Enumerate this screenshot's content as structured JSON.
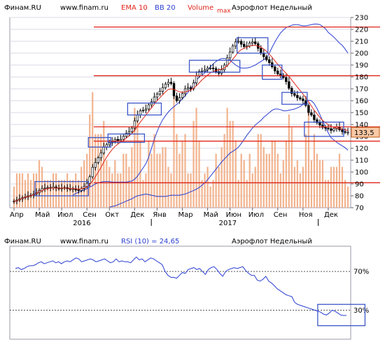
{
  "chart_data": [
    {
      "type": "candlestick",
      "header": {
        "source": "Финам.RU",
        "url": "www.finam.ru",
        "ema": "EMA 10",
        "bb": "BB 20",
        "volume": "Volume",
        "volume_scale": "max",
        "title": "Аэрофлот Недельный"
      },
      "ylim": [
        70,
        230
      ],
      "y_ticks": [
        70,
        80,
        90,
        100,
        110,
        120,
        130,
        140,
        150,
        160,
        170,
        180,
        190,
        200,
        210,
        220,
        230
      ],
      "x_month_labels": [
        "Апр",
        "Май",
        "Июл",
        "Сен",
        "Окт",
        "Дек",
        "Янв",
        "Мар",
        "Май",
        "Июн",
        "Июл",
        "Сен",
        "Ноя",
        "Дек"
      ],
      "x_month_weeks": [
        0,
        9,
        17,
        26,
        34,
        43,
        51,
        60,
        69,
        77,
        85,
        94,
        103,
        112
      ],
      "x_year_labels": [
        "2016",
        "2017"
      ],
      "x_year_weeks": [
        24,
        76
      ],
      "last_price_label": "133,5",
      "last_price": 133.5,
      "horizontal_lines": [
        222,
        181,
        138,
        126,
        91
      ],
      "highlight_boxes": [
        {
          "from_week": 8,
          "to_week": 26,
          "low": 80,
          "high": 92
        },
        {
          "from_week": 27,
          "to_week": 34,
          "low": 121,
          "high": 129
        },
        {
          "from_week": 34,
          "to_week": 46,
          "low": 125,
          "high": 132
        },
        {
          "from_week": 41,
          "to_week": 52,
          "low": 148,
          "high": 158
        },
        {
          "from_week": 63,
          "to_week": 80,
          "low": 184,
          "high": 194
        },
        {
          "from_week": 80,
          "to_week": 90,
          "low": 200,
          "high": 213
        },
        {
          "from_week": 89,
          "to_week": 95,
          "low": 178,
          "high": 190
        },
        {
          "from_week": 96,
          "to_week": 104,
          "low": 157,
          "high": 167
        },
        {
          "from_week": 104,
          "to_week": 117,
          "low": 130,
          "high": 142
        }
      ],
      "weeks": 120,
      "close": [
        75.5,
        76.5,
        77.5,
        78.5,
        79,
        80,
        80.5,
        81.5,
        82.5,
        84.5,
        86,
        86.5,
        87,
        86.5,
        87.5,
        86.5,
        86,
        86.5,
        87,
        86,
        85.5,
        86,
        85,
        84.5,
        86,
        88,
        90.5,
        96,
        104,
        108,
        112,
        116,
        121,
        123,
        124.5,
        125.5,
        127.5,
        126.5,
        127.5,
        130,
        132.5,
        134,
        137,
        143,
        148,
        151.5,
        152,
        153,
        156.5,
        159,
        163,
        165.5,
        168,
        171,
        174,
        175.5,
        174.5,
        164,
        160,
        162.5,
        166,
        170,
        171,
        170,
        175,
        181,
        184.5,
        185,
        186,
        187.5,
        187.5,
        187,
        184.5,
        183,
        186,
        190,
        196,
        201,
        206,
        209.5,
        210,
        207.5,
        205.5,
        206,
        208.5,
        209.5,
        208,
        204,
        200,
        197,
        194.5,
        192,
        188.5,
        185,
        182.5,
        181.5,
        179.5,
        176,
        170.5,
        166,
        164.5,
        162.5,
        161.5,
        160,
        156,
        150,
        148,
        144,
        141.5,
        139.5,
        137.5,
        137,
        136.5,
        135,
        136.5,
        138,
        135.5,
        134,
        133.5,
        133.5
      ],
      "ema": [
        75,
        76,
        77,
        78,
        79,
        79.5,
        80,
        81,
        82,
        83.5,
        84.5,
        85.5,
        86,
        86.5,
        86.5,
        86.5,
        86.5,
        86.5,
        86.5,
        86.5,
        86,
        86,
        86,
        85.5,
        86,
        86.5,
        87.5,
        89.5,
        92.5,
        96,
        100,
        104,
        108.5,
        112.5,
        116,
        119,
        121.5,
        123.5,
        125,
        126.5,
        128.5,
        130.5,
        132.5,
        135,
        138.5,
        142,
        145,
        148,
        151,
        154,
        157,
        160,
        162.5,
        165,
        167.5,
        169.5,
        170,
        169.5,
        168.5,
        167.5,
        167,
        167.5,
        168,
        169,
        170.5,
        172.5,
        175,
        177.5,
        179.5,
        181.5,
        183.5,
        184.5,
        185.5,
        186,
        186.5,
        187.5,
        189.5,
        192,
        195,
        198,
        201,
        203,
        204,
        205,
        206,
        206.5,
        206.5,
        206,
        205,
        203.5,
        201.5,
        199,
        196.5,
        193.5,
        190.5,
        188,
        185.5,
        183,
        180.5,
        177.5,
        174.5,
        171.5,
        168.5,
        165.5,
        162.5,
        159,
        155.5,
        152,
        149,
        146,
        143.5,
        141.5,
        140,
        138.5,
        137.5,
        137,
        136.5,
        136,
        135.5,
        135
      ],
      "bb_upper": [
        80.5,
        82,
        83,
        84,
        85,
        86,
        87.5,
        88.5,
        90,
        91,
        91.5,
        92,
        92,
        92,
        91.5,
        91.5,
        91.5,
        91.5,
        91.5,
        91.5,
        92,
        92.5,
        94,
        96.5,
        100,
        103.5,
        107,
        112.5,
        120,
        127.5,
        134,
        139.5,
        144,
        147.5,
        150.5,
        153,
        155,
        157,
        159,
        161.5,
        164,
        167,
        170,
        173.5,
        177,
        180,
        181.5,
        183.5,
        186,
        188.5,
        191,
        193,
        194.5,
        195.5,
        195.5,
        195,
        194,
        192,
        190,
        188.5,
        187.5,
        187.5,
        187.5,
        188,
        189,
        190,
        191.5,
        193,
        194.5,
        196,
        200,
        205,
        209.5,
        213.5,
        217,
        219.5,
        221.5,
        222.5,
        223.5,
        224,
        224,
        223.5,
        223,
        223,
        223.5,
        224,
        224.5,
        224.5,
        224,
        222.5,
        220.5,
        217.5,
        215.5,
        213.5,
        211,
        208.5,
        206.5,
        203.5,
        200
      ],
      "bb_lower": [
        70.5,
        71,
        71.5,
        72.5,
        73.5,
        74.5,
        75.5,
        76.5,
        77.5,
        79,
        80,
        80.5,
        81,
        81.5,
        81,
        80.5,
        80,
        79.5,
        79.5,
        79.5,
        79.5,
        80,
        80.5,
        80.5,
        80.5,
        80.5,
        81,
        81.5,
        82.5,
        83.5,
        84.5,
        85.5,
        87,
        89,
        91,
        93.5,
        96.5,
        99.5,
        102.5,
        105.5,
        108.5,
        111,
        113.5,
        116,
        117.5,
        119,
        121,
        124,
        127.5,
        131,
        134,
        137,
        139.5,
        141.5,
        143.5,
        146,
        148,
        150,
        152,
        153,
        153,
        152.5,
        151.5,
        151.5,
        152,
        152.5,
        153,
        154,
        155,
        157,
        159,
        160.5,
        160,
        157.5,
        153.5,
        148.5,
        143,
        138,
        133,
        129,
        127,
        125,
        123.5,
        122,
        120.5,
        118.5
      ],
      "volume_max": 230
    },
    {
      "type": "line",
      "header": {
        "source": "Финам.RU",
        "url": "www.finam.ru",
        "rsi": "RSI (10) = 24,65",
        "title": "Аэрофлот Недельный"
      },
      "ylim": [
        0,
        100
      ],
      "levels": [
        70,
        30
      ],
      "level_labels": [
        "70%",
        "30%"
      ],
      "rsi": [
        73,
        74,
        72,
        73,
        75,
        76,
        76,
        77,
        79,
        80,
        78,
        79,
        80,
        81,
        79,
        80,
        78,
        80,
        81,
        80,
        82,
        84,
        83,
        80,
        81,
        82,
        83,
        82,
        80,
        81,
        82,
        83,
        81,
        79,
        80,
        83,
        80,
        81,
        80,
        80,
        79,
        82,
        85,
        82,
        83,
        80,
        82,
        84,
        83,
        81,
        79,
        77,
        70,
        66,
        64,
        64,
        63,
        66,
        69,
        68,
        72,
        73,
        74,
        72,
        73,
        70,
        67,
        72,
        74,
        75,
        72,
        68,
        65,
        70,
        72,
        73,
        74,
        73,
        74,
        75,
        71,
        68,
        66,
        66,
        61,
        60,
        62,
        65,
        60,
        58,
        55,
        52,
        50,
        48,
        46,
        45,
        44,
        38,
        36,
        35,
        34,
        33,
        32,
        31,
        30,
        29,
        28,
        26,
        25,
        27,
        30,
        29,
        27,
        25,
        24.5,
        24.65
      ],
      "highlight_box": {
        "from_index": 105,
        "to_index": 119,
        "low": 14,
        "high": 36
      }
    }
  ]
}
